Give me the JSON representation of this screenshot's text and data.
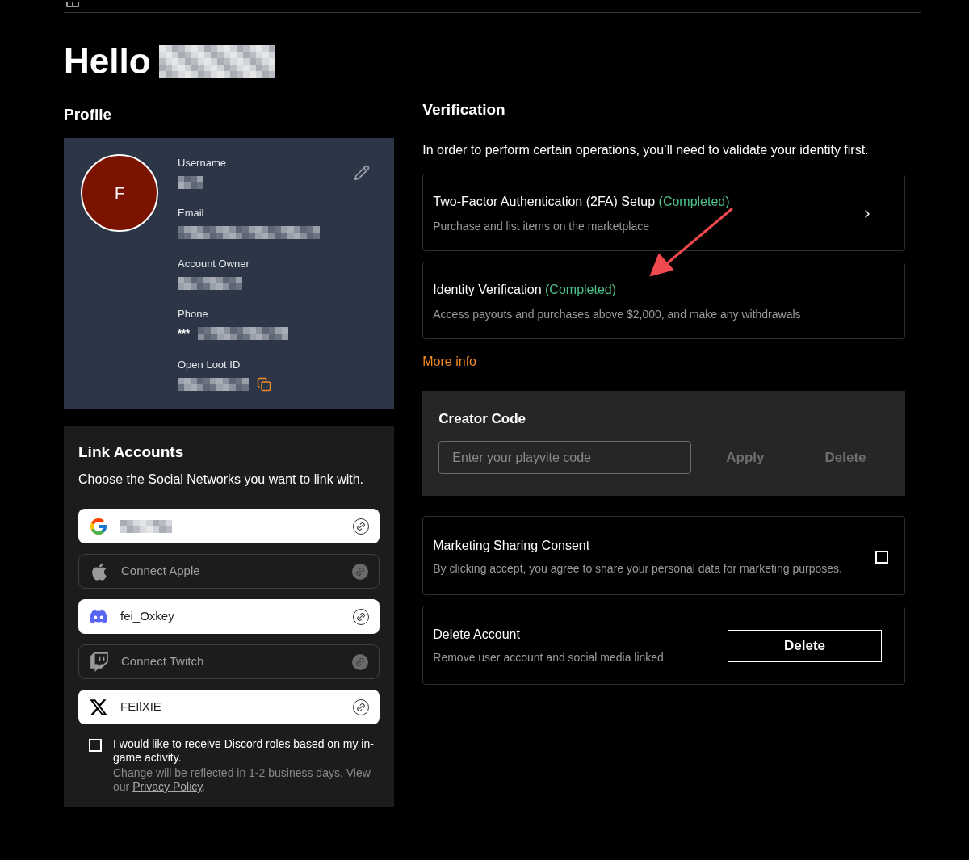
{
  "greeting": "Hello",
  "profile": {
    "heading": "Profile",
    "avatar_letter": "F",
    "fields": [
      {
        "label": "Username"
      },
      {
        "label": "Email"
      },
      {
        "label": "Account Owner"
      },
      {
        "label": "Phone",
        "prefix": "***"
      },
      {
        "label": "Open Loot ID",
        "copyable": true
      }
    ]
  },
  "link_accounts": {
    "heading": "Link Accounts",
    "subtitle": "Choose the Social Networks you want to link with.",
    "accounts": [
      {
        "kind": "google",
        "linked": true
      },
      {
        "kind": "apple",
        "label": "Connect Apple",
        "linked": false
      },
      {
        "kind": "discord",
        "label": "fei_Oxkey",
        "linked": true
      },
      {
        "kind": "twitch",
        "label": "Connect Twitch",
        "linked": false
      },
      {
        "kind": "x",
        "label": "FEIlXIE",
        "linked": true
      }
    ],
    "discord_roles": {
      "checked": false,
      "text": "I would like to receive Discord roles based on my in-game activity.",
      "note": "Change will be reflected in 1-2 business days. View our",
      "link": "Privacy Policy",
      "note_end": "."
    }
  },
  "verification": {
    "heading": "Verification",
    "intro": "In order to perform certain operations, you’ll need to validate your identity first.",
    "steps": [
      {
        "title": "Two-Factor Authentication (2FA) Setup",
        "status": "(Completed)",
        "description": "Purchase and list items on the marketplace",
        "chevron": true
      },
      {
        "title": "Identity Verification",
        "status": "(Completed)",
        "description": "Access payouts and purchases above $2,000, and make any withdrawals"
      }
    ],
    "more_info": "More info"
  },
  "creator_code": {
    "heading": "Creator Code",
    "placeholder": "Enter your playvite code",
    "apply": "Apply",
    "delete": "Delete"
  },
  "marketing": {
    "title": "Marketing Sharing Consent",
    "description": "By clicking accept, you agree to share your personal data for marketing purposes.",
    "checked": false
  },
  "delete_account": {
    "title": "Delete Account",
    "description": "Remove user account and social media linked",
    "button": "Delete"
  }
}
